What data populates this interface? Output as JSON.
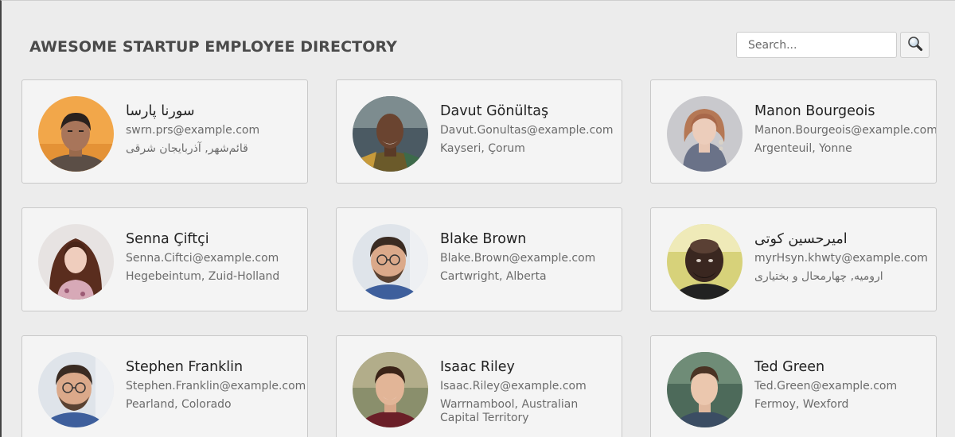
{
  "header": {
    "title": "AWESOME STARTUP EMPLOYEE DIRECTORY"
  },
  "search": {
    "placeholder": "Search...",
    "value": "",
    "button_icon": "search-icon"
  },
  "employees": [
    {
      "name": "سورنا پارسا",
      "email": "swrn.prs@example.com",
      "location": "قائم‌شهر, آذربایجان شرقی"
    },
    {
      "name": "Davut Gönültaş",
      "email": "Davut.Gonultas@example.com",
      "location": "Kayseri, Çorum"
    },
    {
      "name": "Manon Bourgeois",
      "email": "Manon.Bourgeois@example.com",
      "location": "Argenteuil, Yonne"
    },
    {
      "name": "Senna Çiftçi",
      "email": "Senna.Ciftci@example.com",
      "location": "Hegebeintum, Zuid-Holland"
    },
    {
      "name": "Blake Brown",
      "email": "Blake.Brown@example.com",
      "location": "Cartwright, Alberta"
    },
    {
      "name": "امیرحسین کوتی",
      "email": "myrHsyn.khwty@example.com",
      "location": "ارومیه, چهارمحال و بختیاری"
    },
    {
      "name": "Stephen Franklin",
      "email": "Stephen.Franklin@example.com",
      "location": "Pearland, Colorado"
    },
    {
      "name": "Isaac Riley",
      "email": "Isaac.Riley@example.com",
      "location": "Warrnambool, Australian Capital Territory"
    },
    {
      "name": "Ted Green",
      "email": "Ted.Green@example.com",
      "location": "Fermoy, Wexford"
    }
  ]
}
